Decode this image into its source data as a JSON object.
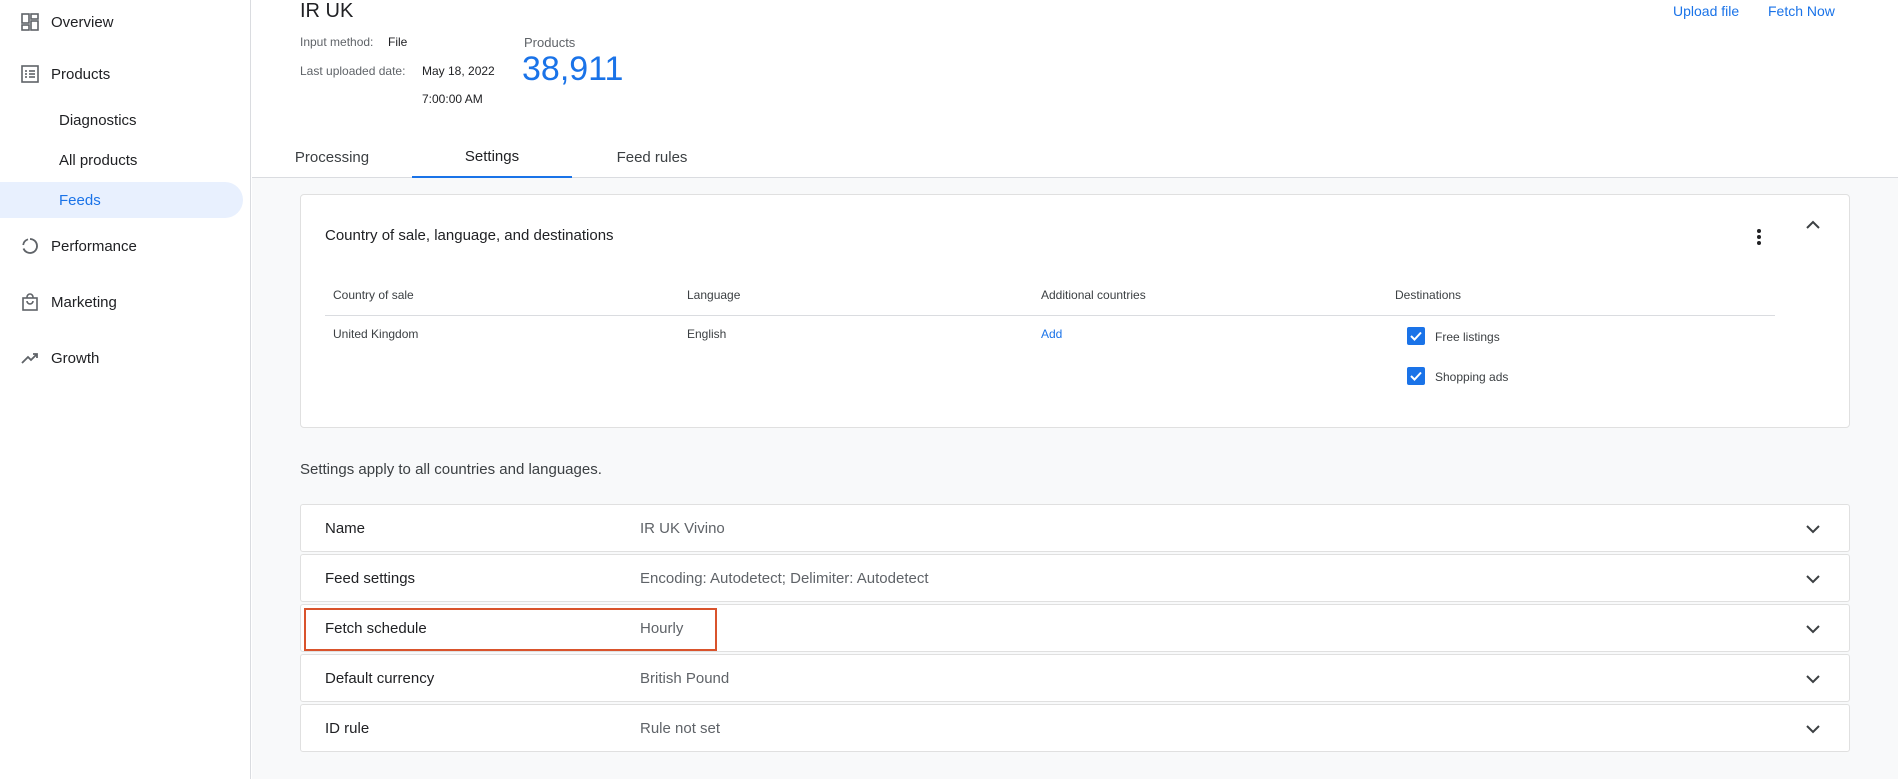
{
  "sidebar": {
    "items": [
      {
        "label": "Overview",
        "icon": "dashboard-icon"
      },
      {
        "label": "Products",
        "icon": "list-icon"
      },
      {
        "label": "Diagnostics"
      },
      {
        "label": "All products"
      },
      {
        "label": "Feeds",
        "active": true
      },
      {
        "label": "Performance",
        "icon": "circle-chart-icon"
      },
      {
        "label": "Marketing",
        "icon": "shopping-bag-icon"
      },
      {
        "label": "Growth",
        "icon": "trending-up-icon"
      }
    ]
  },
  "header": {
    "title": "IR UK",
    "input_method_label": "Input method:",
    "input_method_value": "File",
    "last_uploaded_label": "Last uploaded date:",
    "last_uploaded_date": "May 18, 2022",
    "last_uploaded_time": "7:00:00 AM",
    "products_label": "Products",
    "products_count": "38,911",
    "upload_file": "Upload file",
    "fetch_now": "Fetch Now"
  },
  "tabs": [
    {
      "label": "Processing"
    },
    {
      "label": "Settings",
      "active": true
    },
    {
      "label": "Feed rules"
    }
  ],
  "country_card": {
    "title": "Country of sale, language, and destinations",
    "columns": [
      "Country of sale",
      "Language",
      "Additional countries",
      "Destinations"
    ],
    "row": {
      "country": "United Kingdom",
      "language": "English",
      "additional": "Add",
      "destinations": [
        {
          "label": "Free listings",
          "checked": true
        },
        {
          "label": "Shopping ads",
          "checked": true
        }
      ]
    }
  },
  "settings_note": "Settings apply to all countries and languages.",
  "settings_rows": [
    {
      "name": "Name",
      "value": "IR UK Vivino"
    },
    {
      "name": "Feed settings",
      "value": "Encoding: Autodetect; Delimiter: Autodetect"
    },
    {
      "name": "Fetch schedule",
      "value": "Hourly",
      "highlighted": true
    },
    {
      "name": "Default currency",
      "value": "British Pound"
    },
    {
      "name": "ID rule",
      "value": "Rule not set"
    }
  ],
  "colors": {
    "accent": "#1a73e8",
    "highlight": "#d9532c",
    "active_nav_bg": "#e8f0fe"
  }
}
